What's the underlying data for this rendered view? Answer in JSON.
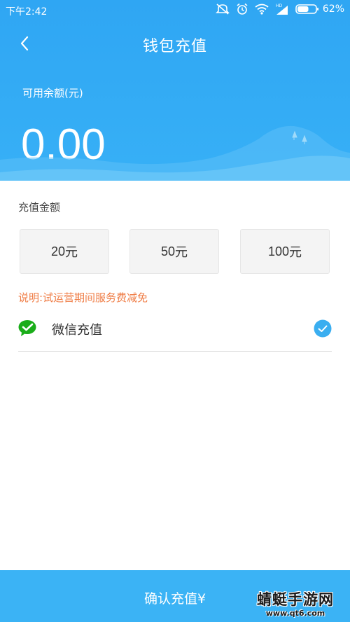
{
  "status_bar": {
    "time": "下午2:42",
    "battery_percent": "62%",
    "battery_level": 0.62
  },
  "nav": {
    "title": "钱包充值"
  },
  "balance": {
    "label": "可用余额(元)",
    "value": "0.00"
  },
  "recharge": {
    "section_label": "充值金额",
    "amounts": [
      {
        "value": "20",
        "unit": "元"
      },
      {
        "value": "50",
        "unit": "元"
      },
      {
        "value": "100",
        "unit": "元"
      }
    ],
    "notice": "说明:试运营期间服务费减免"
  },
  "payment": {
    "method_label": "微信充值",
    "selected": true
  },
  "confirm": {
    "label": "确认充值¥"
  },
  "watermark": {
    "title": "蜻蜓手游网",
    "url": "www.qt6.com"
  },
  "colors": {
    "header_blue": "#37b0f6",
    "confirm_blue": "#3bb3f5",
    "notice_orange": "#ef7b43",
    "check_blue": "#3aaef0",
    "wechat_green": "#1aad19"
  }
}
